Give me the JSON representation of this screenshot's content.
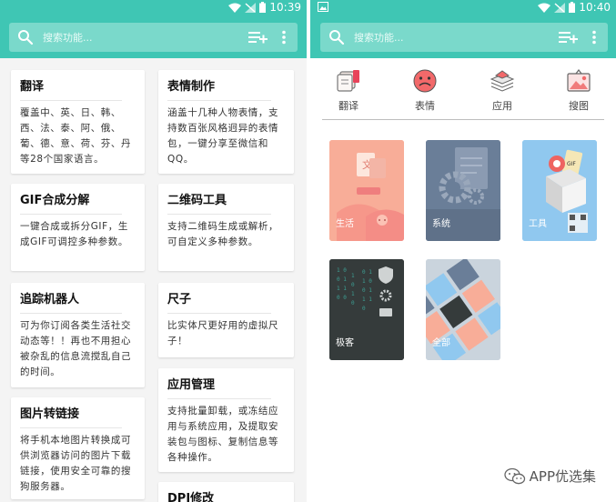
{
  "left": {
    "status": {
      "time": "10:39"
    },
    "search": {
      "placeholder": "搜索功能..."
    },
    "cards": [
      {
        "title": "翻译",
        "desc": "覆盖中、英、日、韩、西、法、泰、阿、俄、葡、德、意、荷、芬、丹等28个国家语言。"
      },
      {
        "title": "表情制作",
        "desc": "涵盖十几种人物表情，支持数百张风格迥异的表情包，一键分享至微信和QQ。"
      },
      {
        "title": "GIF合成分解",
        "desc": "一键合成或拆分GIF，生成GIF可调控多种参数。"
      },
      {
        "title": "二维码工具",
        "desc": "支持二维码生成或解析，可自定义多种参数。"
      },
      {
        "title": "追踪机器人",
        "desc": "可为你订阅各类生活社交动态等！！再也不用担心被杂乱的信息流搅乱自己的时间。"
      },
      {
        "title": "尺子",
        "desc": "比实体尺更好用的虚拟尺子！"
      },
      {
        "title": "图片转链接",
        "desc": "将手机本地图片转换成可供浏览器访问的图片下载链接，使用安全可靠的搜狗服务器。"
      },
      {
        "title": "应用管理",
        "desc": "支持批量卸载，或冻结应用与系统应用，及提取安装包与图标、复制信息等各种操作。"
      },
      {
        "title": "DPI修改",
        "desc": ""
      }
    ]
  },
  "right": {
    "status": {
      "time": "10:40"
    },
    "search": {
      "placeholder": "搜索功能..."
    },
    "categories": [
      {
        "label": "翻译",
        "icon": "translate-icon"
      },
      {
        "label": "表情",
        "icon": "emoji-face-icon"
      },
      {
        "label": "应用",
        "icon": "layers-icon"
      },
      {
        "label": "搜图",
        "icon": "image-search-icon"
      }
    ],
    "tiles": [
      {
        "label": "生活",
        "color": "#f7a58f"
      },
      {
        "label": "系统",
        "color": "#6b7f99"
      },
      {
        "label": "工具",
        "color": "#8fc7ef"
      },
      {
        "label": "极客",
        "color": "#333a3a"
      },
      {
        "label": "全部",
        "color": "#c9d3dc"
      }
    ]
  },
  "watermark": {
    "text": "APP优选集"
  },
  "colors": {
    "accent": "#3fc6b4",
    "search_bg": "#7ad9cb"
  }
}
